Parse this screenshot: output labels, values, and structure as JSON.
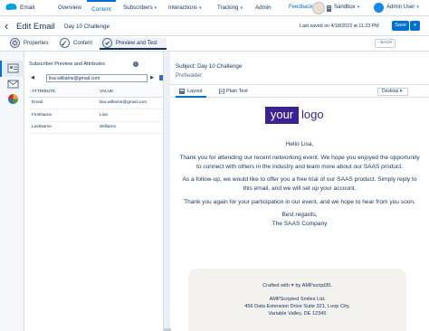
{
  "topnav": {
    "app_name": "Email",
    "tabs": [
      {
        "label": "Overview",
        "caret": false
      },
      {
        "label": "Content",
        "caret": false,
        "active": true
      },
      {
        "label": "Subscribers",
        "caret": true
      },
      {
        "label": "Interactions",
        "caret": true
      },
      {
        "label": "Tracking",
        "caret": true
      },
      {
        "label": "Admin",
        "caret": false
      }
    ],
    "feedback": "Feedback",
    "business_unit": "Sandbox",
    "user": "Admin User",
    "caret_glyph": "▾"
  },
  "titlebar": {
    "back_glyph": "‹",
    "title": "Edit Email",
    "email_name": "Day 10 Challenge",
    "last_saved": "Last saved on 4/18/2023 at 11:23 PM",
    "save_label": "Save",
    "save_caret": "▾"
  },
  "steps": [
    {
      "label": "Properties",
      "icon": "gear-icon"
    },
    {
      "label": "Content",
      "icon": "paintbrush-icon"
    },
    {
      "label": "Preview and Test",
      "icon": "checkmark-icon",
      "active": true
    }
  ],
  "back_button": "‹ BACK",
  "left_strip": {
    "icons": [
      "person-card-icon",
      "email-envelope-icon",
      "color-wheel-icon"
    ]
  },
  "preview": {
    "header": "Subscriber Preview and Attributes",
    "info_glyph": "i",
    "prev_glyph": "◀",
    "next_glyph": "▶",
    "subscriber": "lisa.williams@gmail.com",
    "columns": [
      "ATTRIBUTE",
      "VALUE"
    ],
    "rows": [
      {
        "attribute": "Email",
        "value": "lisa.williams@gmail.com"
      },
      {
        "attribute": "FirstName",
        "value": "Lisa"
      },
      {
        "attribute": "LastName",
        "value": "Williams"
      }
    ]
  },
  "email": {
    "subject_label": "Subject: Day 10 Challenge",
    "preheader_label": "Preheader:",
    "view_tabs": [
      "Layout",
      "Plain Text"
    ],
    "device": "Desktop",
    "device_caret": "▾",
    "logo_box": "your",
    "logo_word": "logo",
    "greeting": "Hello Lisa,",
    "para1": "Thank you for attending our recent networking event. We hope you enjoyed the opportunity to connect with others in the industry and learn more about our SAAS product.",
    "para2": "As a follow-up, we would like to offer you a free trial of our SAAS product. Simply reply to this email, and we will set up your account.",
    "para3": "Thank you again for your participation in our event, and we hope to hear from you soon.",
    "signoff": "Best regards,",
    "signature": "The SAAS Company",
    "footer_crafted_pre": "Crafted with",
    "footer_heart": "♥",
    "footer_crafted_post": "by AMPscript30.",
    "footer_company": "AMPScripted Smiles Ltd.",
    "footer_address": "456 Data Extension Drive Suite 321, Loop City,",
    "footer_city": "Variable Valley, DE 12345"
  },
  "colors": {
    "accent": "#0070d2",
    "brand": "#3b2293",
    "heart": "#7a3fc4"
  }
}
